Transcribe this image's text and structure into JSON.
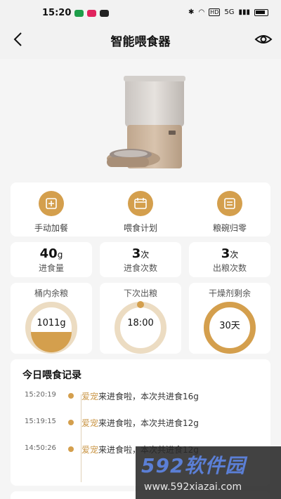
{
  "status_bar": {
    "time": "15:20",
    "network": "5G"
  },
  "nav": {
    "title": "智能喂食器"
  },
  "actions": [
    {
      "label": "手动加餐",
      "icon": "add-meal-icon"
    },
    {
      "label": "喂食计划",
      "icon": "calendar-icon"
    },
    {
      "label": "粮碗归零",
      "icon": "bowl-reset-icon"
    }
  ],
  "stats": [
    {
      "value": "40",
      "unit": "g",
      "label": "进食量"
    },
    {
      "value": "3",
      "unit": "次",
      "label": "进食次数"
    },
    {
      "value": "3",
      "unit": "次",
      "label": "出粮次数"
    }
  ],
  "gauges": [
    {
      "label": "桶内余粮",
      "value": "1011g"
    },
    {
      "label": "下次出粮",
      "value": "18:00"
    },
    {
      "label": "干燥剂剩余",
      "value": "30天"
    }
  ],
  "records": {
    "heading": "今日喂食记录",
    "items": [
      {
        "time": "15:20:19",
        "pet": "爱宠",
        "text": "来进食啦，本次共进食16g"
      },
      {
        "time": "15:19:15",
        "pet": "爱宠",
        "text": "来进食啦，本次共进食12g"
      },
      {
        "time": "14:50:26",
        "pet": "爱宠",
        "text": "来进食啦，本次共进食12g"
      }
    ]
  },
  "watermark": {
    "brand": "592软件园",
    "url": "www.592xiazai.com"
  },
  "colors": {
    "accent": "#d49f4d",
    "ring_light": "#ecdcc2",
    "background": "#f5f5f5"
  }
}
